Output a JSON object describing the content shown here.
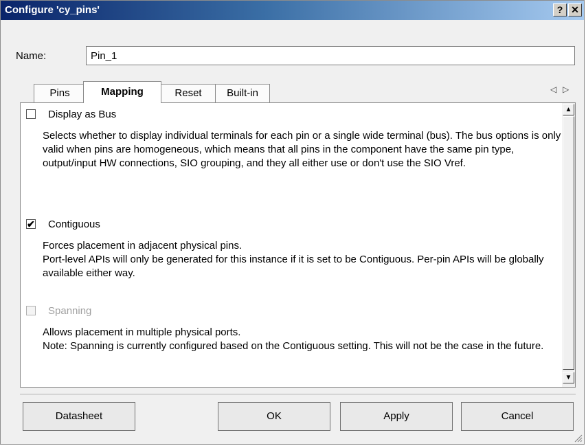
{
  "window": {
    "title": "Configure 'cy_pins'",
    "help_label": "?",
    "close_label": "✕"
  },
  "name_field": {
    "label": "Name:",
    "value": "Pin_1"
  },
  "tabs": [
    {
      "label": "Pins",
      "active": false
    },
    {
      "label": "Mapping",
      "active": true
    },
    {
      "label": "Reset",
      "active": false
    },
    {
      "label": "Built-in",
      "active": false
    }
  ],
  "tab_scroll": {
    "left": "◁",
    "right": "▷"
  },
  "scrollbar": {
    "up": "▲",
    "down": "▼"
  },
  "options": [
    {
      "label": "Display as Bus",
      "checked": false,
      "enabled": true,
      "check_glyph": "",
      "description": "Selects whether to display individual terminals for each pin or a single wide terminal (bus). The bus options is only valid when pins are homogeneous, which means that all pins in the component have the same pin type, output/input HW connections,  SIO grouping, and they all either use or don't use the SIO Vref."
    },
    {
      "label": "Contiguous",
      "checked": true,
      "enabled": true,
      "check_glyph": "✔",
      "description_lines": [
        "Forces placement in adjacent physical pins.",
        "Port-level APIs will only be generated for this instance if it is set to be Contiguous. Per-pin APIs will be globally available either way."
      ]
    },
    {
      "label": "Spanning",
      "checked": false,
      "enabled": false,
      "check_glyph": "",
      "description_lines": [
        "Allows placement in multiple physical ports.",
        "Note: Spanning is currently configured based on the Contiguous setting. This will not be the case in the future."
      ]
    }
  ],
  "buttons": {
    "datasheet": "Datasheet",
    "ok": "OK",
    "apply": "Apply",
    "cancel": "Cancel"
  }
}
